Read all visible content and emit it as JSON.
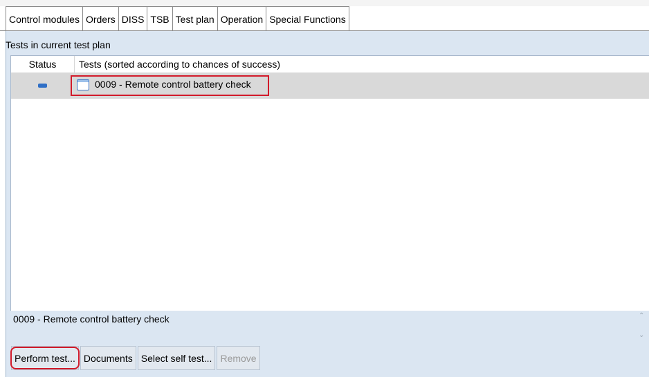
{
  "tabs": [
    {
      "label": "Control modules"
    },
    {
      "label": "Orders"
    },
    {
      "label": "DISS"
    },
    {
      "label": "TSB"
    },
    {
      "label": "Test plan",
      "active": true
    },
    {
      "label": "Operation"
    },
    {
      "label": "Special Functions"
    }
  ],
  "panel": {
    "title": "Tests in current test plan"
  },
  "grid": {
    "columns": {
      "status": "Status",
      "tests": "Tests (sorted according to chances of success)"
    },
    "rows": [
      {
        "status_icon": "status-dash-icon",
        "icon": "document-icon",
        "label": "0009  - Remote control battery check"
      }
    ]
  },
  "detail": {
    "text": "0009  - Remote control battery check"
  },
  "buttons": {
    "perform": "Perform test...",
    "documents": "Documents",
    "select_self_test": "Select self test...",
    "remove": "Remove"
  },
  "colors": {
    "panel_bg": "#dbe6f2",
    "selected_row": "#d9d9d9",
    "highlight_red": "#d21a2a",
    "status_blue": "#2f6fc6"
  }
}
